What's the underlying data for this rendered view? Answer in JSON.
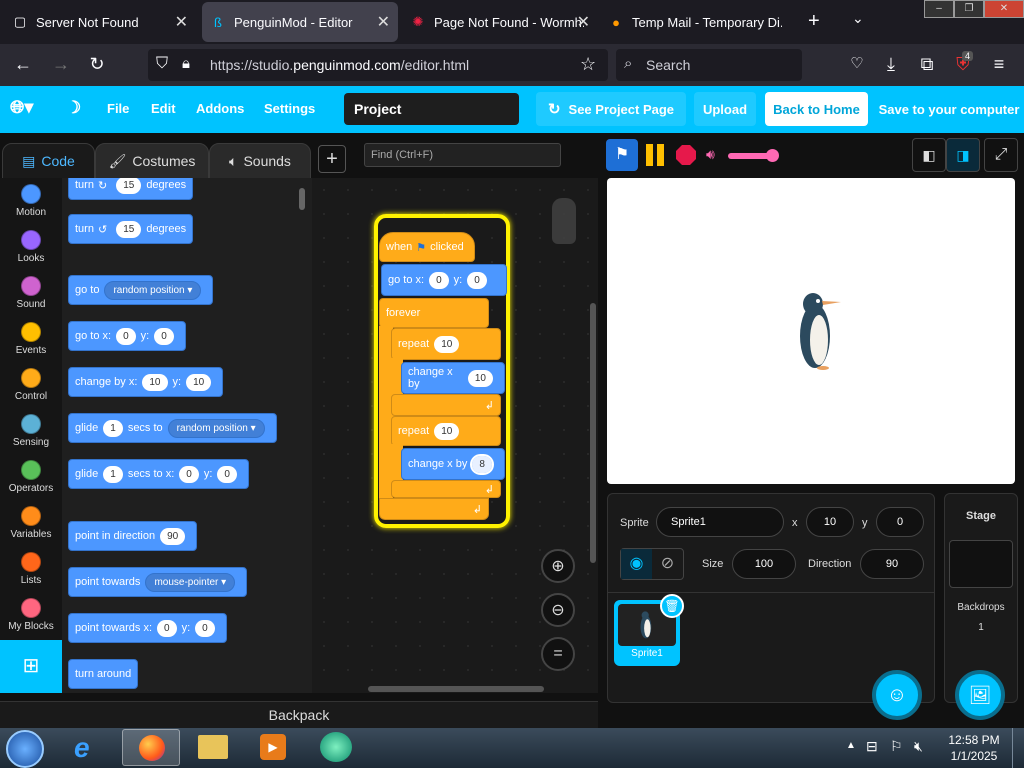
{
  "browser": {
    "tabs": [
      {
        "title": "Server Not Found",
        "icon": "page-icon"
      },
      {
        "title": "PenguinMod - Editor",
        "icon": "penguinmod-icon"
      },
      {
        "title": "Page Not Found - Wormh...",
        "icon": "wormhole-icon"
      },
      {
        "title": "Temp Mail - Temporary Di...",
        "icon": "tempmail-icon"
      }
    ],
    "url_prefix": "https://studio.",
    "url_domain": "penguinmod.com",
    "url_path": "/editor.html",
    "search_placeholder": "Search",
    "ext_badge": "4"
  },
  "menubar": {
    "file": "File",
    "edit": "Edit",
    "addons": "Addons",
    "settings": "Settings",
    "project_title": "Project",
    "see_project_page": "See Project Page",
    "upload": "Upload",
    "back_to_home": "Back to Home",
    "save_to_computer": "Save to your computer",
    "accent": "#00c3ff"
  },
  "editor_tabs": {
    "code": "Code",
    "costumes": "Costumes",
    "sounds": "Sounds"
  },
  "find_placeholder": "Find (Ctrl+F)",
  "categories": [
    {
      "label": "Motion",
      "color": "#4c97ff"
    },
    {
      "label": "Looks",
      "color": "#9966ff"
    },
    {
      "label": "Sound",
      "color": "#cf63cf"
    },
    {
      "label": "Events",
      "color": "#ffbf00"
    },
    {
      "label": "Control",
      "color": "#ffab19"
    },
    {
      "label": "Sensing",
      "color": "#5cb1d6"
    },
    {
      "label": "Operators",
      "color": "#59c059"
    },
    {
      "label": "Variables",
      "color": "#ff8c1a"
    },
    {
      "label": "Lists",
      "color": "#ff661a"
    },
    {
      "label": "My Blocks",
      "color": "#ff6680"
    }
  ],
  "palette": {
    "turn_right": {
      "a": "turn",
      "v": "15",
      "b": "degrees"
    },
    "turn_left": {
      "a": "turn",
      "v": "15",
      "b": "degrees"
    },
    "go_to": {
      "a": "go to",
      "dd": "random position"
    },
    "go_to_xy": {
      "a": "go to x:",
      "x": "0",
      "b": "y:",
      "y": "0"
    },
    "change_by": {
      "a": "change by x:",
      "x": "10",
      "b": "y:",
      "y": "10"
    },
    "glide_to": {
      "a": "glide",
      "v": "1",
      "b": "secs to",
      "dd": "random position"
    },
    "glide_xy": {
      "a": "glide",
      "v": "1",
      "b": "secs to x:",
      "x": "0",
      "c": "y:",
      "y": "0"
    },
    "point_dir": {
      "a": "point in direction",
      "v": "90"
    },
    "point_towards": {
      "a": "point towards",
      "dd": "mouse-pointer"
    },
    "point_towards_xy": {
      "a": "point towards x:",
      "x": "0",
      "b": "y:",
      "y": "0"
    },
    "turn_around": {
      "a": "turn around"
    }
  },
  "script": {
    "hat_a": "when",
    "hat_b": "clicked",
    "goto_a": "go to x:",
    "goto_x": "0",
    "goto_b": "y:",
    "goto_y": "0",
    "forever": "forever",
    "repeat1": "repeat",
    "repeat1_v": "10",
    "change1": "change x by",
    "change1_v": "10",
    "repeat2": "repeat",
    "repeat2_v": "10",
    "change2": "change x by",
    "change2_v": "8"
  },
  "backpack": "Backpack",
  "sprite_info": {
    "sprite_label": "Sprite",
    "sprite_name": "Sprite1",
    "x_label": "x",
    "x": "10",
    "y_label": "y",
    "y": "0",
    "size_label": "Size",
    "size": "100",
    "direction_label": "Direction",
    "direction": "90",
    "thumb_name": "Sprite1"
  },
  "stage_pane": {
    "title": "Stage",
    "backdrops_label": "Backdrops",
    "backdrops": "1"
  },
  "taskbar": {
    "time": "12:58 PM",
    "date": "1/1/2025"
  }
}
